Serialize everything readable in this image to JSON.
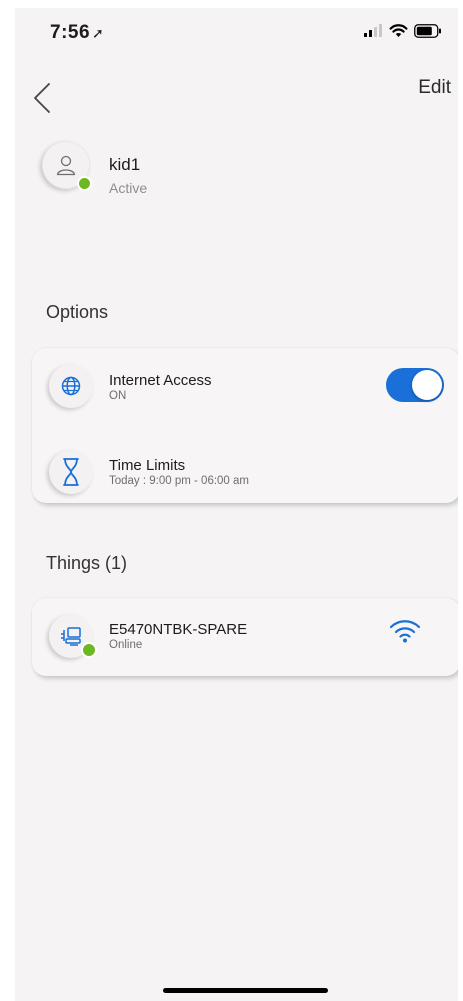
{
  "status_bar": {
    "time": "7:56",
    "location_glyph": "➚"
  },
  "nav": {
    "edit_label": "Edit"
  },
  "profile": {
    "name": "kid1",
    "status": "Active",
    "status_color": "#6bb824"
  },
  "options": {
    "section_title": "Options",
    "items": [
      {
        "title": "Internet Access",
        "subtitle": "ON",
        "icon": "globe-icon",
        "toggle_on": true
      },
      {
        "title": "Time Limits",
        "subtitle": "Today : 9:00 pm - 06:00 am",
        "icon": "hourglass-icon"
      }
    ]
  },
  "things": {
    "section_title": "Things (1)",
    "items": [
      {
        "name": "E5470NTBK-SPARE",
        "status": "Online",
        "icon": "computer-network-icon",
        "connection_icon": "wifi-icon"
      }
    ]
  },
  "colors": {
    "accent": "#1a6fd8",
    "online": "#6bb824",
    "background": "#f5f3f3"
  }
}
